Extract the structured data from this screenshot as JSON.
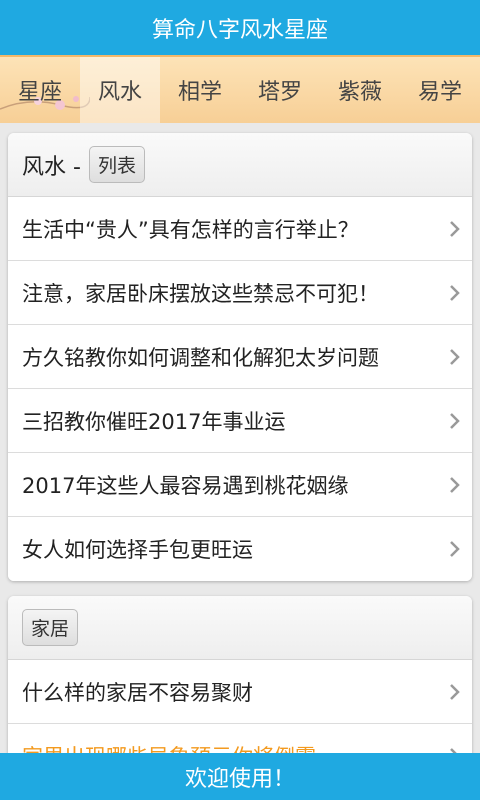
{
  "app": {
    "title": "算命八字风水星座"
  },
  "tabs": [
    {
      "label": "星座",
      "active": false
    },
    {
      "label": "风水",
      "active": true
    },
    {
      "label": "相学",
      "active": false
    },
    {
      "label": "塔罗",
      "active": false
    },
    {
      "label": "紫薇",
      "active": false
    },
    {
      "label": "易学",
      "active": false
    }
  ],
  "section1": {
    "title": "风水 -",
    "chip": "列表",
    "items": [
      "生活中“贵人”具有怎样的言行举止？",
      "注意，家居卧床摆放这些禁忌不可犯！",
      "方久铭教你如何调整和化解犯太岁问题",
      "三招教你催旺2017年事业运",
      "2017年这些人最容易遇到桃花姻缘",
      "女人如何选择手包更旺运"
    ]
  },
  "section2": {
    "chip": "家居",
    "items": [
      "什么样的家居不容易聚财",
      "家里出现哪些异象预示你将倒霉"
    ]
  },
  "bottom": {
    "message": "欢迎使用！"
  },
  "colors": {
    "primary": "#1fa9e1",
    "tab_bg": "#f7cf96",
    "highlight": "#f39a1f"
  },
  "icons": {
    "chevron": "chevron-right-icon"
  }
}
